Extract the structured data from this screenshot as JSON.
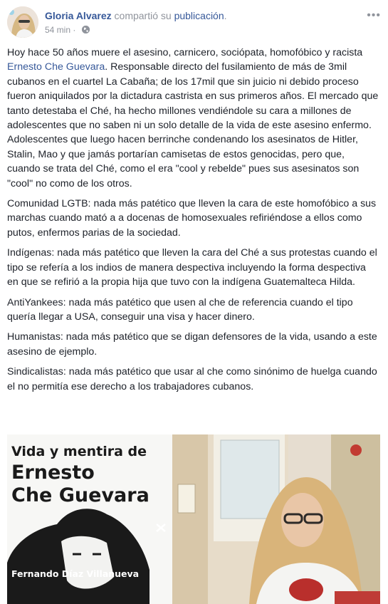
{
  "post": {
    "author": "Gloria Alvarez",
    "shared_text": "compartió su",
    "shared_link": "publicación",
    "shared_end": ".",
    "time": "54 min",
    "more_label": "•••"
  },
  "body": {
    "p1_a": "Hoy hace 50 años muere el asesino, carnicero, sociópata, homofóbico y racista ",
    "p1_mention": "Ernesto Che Guevara",
    "p1_b": ". Responsable directo del fusilamiento de más de 3mil cubanos en el cuartel La Cabaña; de los 17mil que sin juicio ni debido proceso fueron aniquilados por la dictadura castrista en sus primeros años. El mercado que tanto detestaba el Ché, ha hecho millones vendiéndole su cara a millones de adolescentes que no saben ni un solo detalle de la vida de este asesino enfermo. Adolescentes que luego hacen berrinche condenando los asesinatos de Hitler, Stalin, Mao y que jamás portarían camisetas de estos genocidas, pero que, cuando se trata del Ché, como el era \"cool y rebelde\" pues sus asesinatos son \"cool\" no como de los otros.",
    "p2": "Comunidad LGTB: nada más patético que lleven la cara de este homofóbico a sus marchas cuando mató a a docenas de homosexuales refiriéndose a ellos como putos, enfermos parias de la sociedad.",
    "p3": "Indígenas: nada más patético que lleven la cara del Ché a sus protestas cuando el tipo se refería a los indios de manera despectiva incluyendo la forma despectiva en que se refirió a la propia hija que tuvo con la indígena Guatemalteca Hilda.",
    "p4": "AntiYankees: nada más patético que usen al che de referencia cuando el tipo quería llegar a USA, conseguir una visa y hacer dinero.",
    "p5": "Humanistas: nada más patético que se digan defensores de la vida, usando a este asesino de ejemplo.",
    "p6": "Sindicalistas: nada más patético que usar al che como sinónimo de huelga cuando el no permitía ese derecho a los trabajadores cubanos."
  },
  "photo": {
    "line1": "Vida y mentira de",
    "line2": "Ernesto",
    "line3": "Che Guevara",
    "author": "Fernando Díaz Villanueva"
  }
}
